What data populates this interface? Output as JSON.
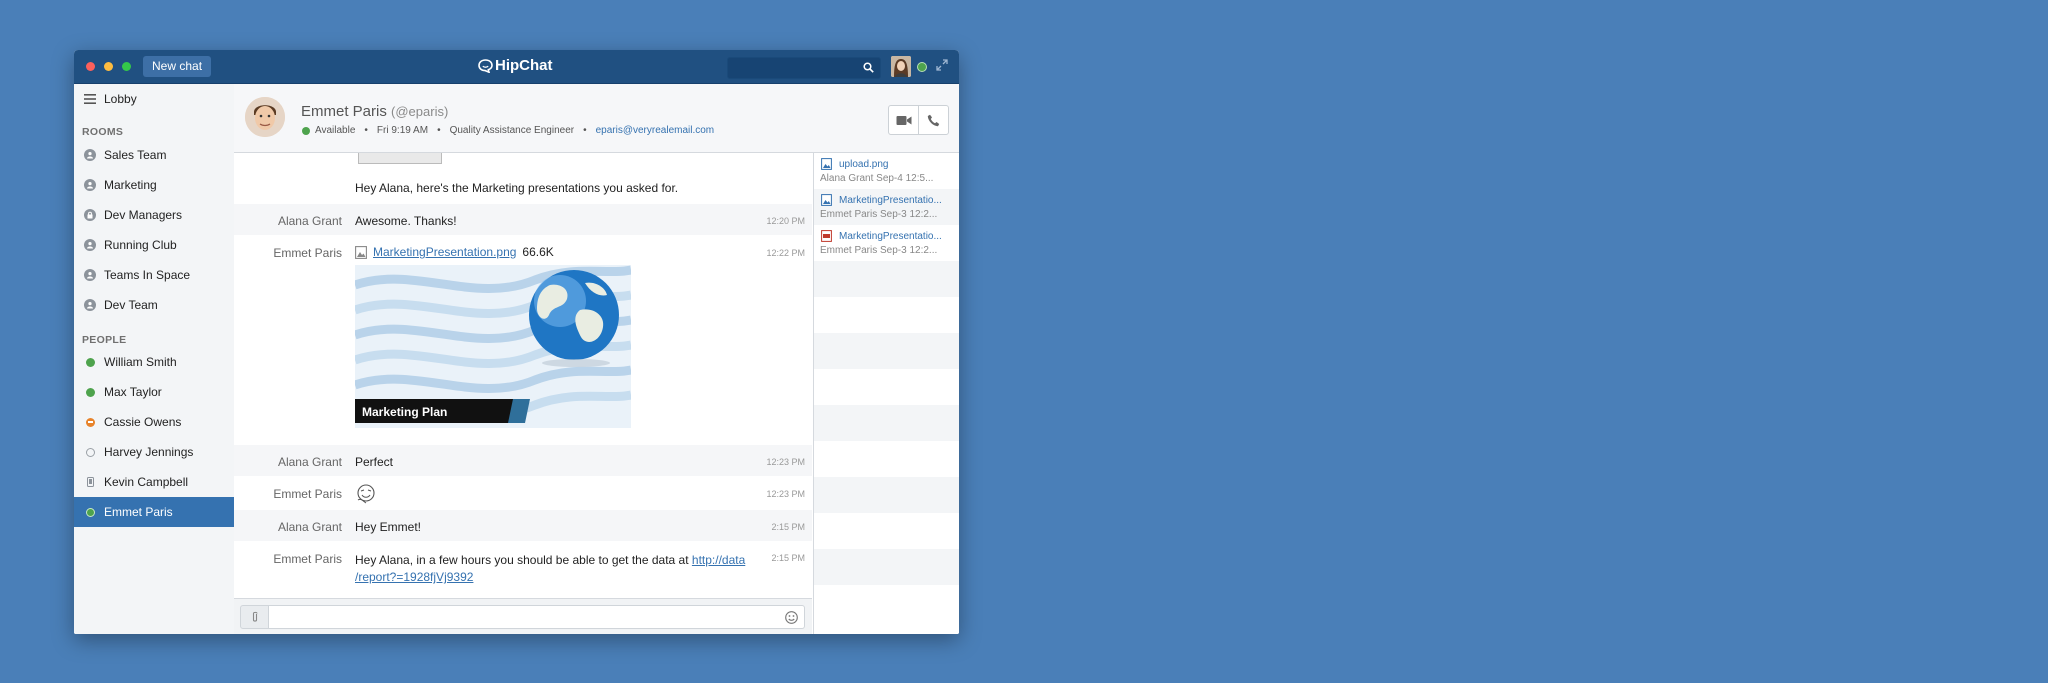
{
  "titlebar": {
    "new_chat_label": "New chat",
    "app_title": "HipChat",
    "search_placeholder": ""
  },
  "sidebar": {
    "lobby_label": "Lobby",
    "rooms_header": "ROOMS",
    "rooms": [
      {
        "label": "Sales Team"
      },
      {
        "label": "Marketing"
      },
      {
        "label": "Dev Managers"
      },
      {
        "label": "Running Club"
      },
      {
        "label": "Teams In Space"
      },
      {
        "label": "Dev Team"
      }
    ],
    "people_header": "PEOPLE",
    "people": [
      {
        "label": "William Smith",
        "status": "available"
      },
      {
        "label": "Max Taylor",
        "status": "available"
      },
      {
        "label": "Cassie Owens",
        "status": "dnd"
      },
      {
        "label": "Harvey Jennings",
        "status": "offline"
      },
      {
        "label": "Kevin Campbell",
        "status": "mobile"
      },
      {
        "label": "Emmet Paris",
        "status": "available",
        "active": true
      }
    ]
  },
  "chat_header": {
    "name": "Emmet Paris",
    "handle": "(@eparis)",
    "status": "Available",
    "local_time": "Fri 9:19 AM",
    "title": "Quality Assistance Engineer",
    "email": "eparis@veryrealemail.com",
    "separator": "•"
  },
  "messages": [
    {
      "sender": "",
      "text": "Hey Alana, here's the Marketing presentations you asked for.",
      "time": ""
    },
    {
      "sender": "Alana Grant",
      "text": "Awesome. Thanks!",
      "time": "12:20 PM"
    },
    {
      "sender": "Emmet Paris",
      "file_name": "MarketingPresentation.png",
      "file_size": "66.6K",
      "preview_caption": "Marketing Plan",
      "time": "12:22 PM"
    },
    {
      "sender": "Alana Grant",
      "text": "Perfect",
      "time": "12:23 PM"
    },
    {
      "sender": "Emmet Paris",
      "text": "",
      "emoticon": "emoticon",
      "time": "12:23 PM"
    },
    {
      "sender": "Alana Grant",
      "text": "Hey Emmet!",
      "time": "2:15 PM"
    },
    {
      "sender": "Emmet Paris",
      "text": "Hey Alana, in a few hours you should be able to get the data at ",
      "link_line1": "http://data",
      "link_line2": "/report?=1928fjVj9392",
      "time": "2:15 PM"
    }
  ],
  "composer": {
    "placeholder": ""
  },
  "files": [
    {
      "name": "upload.png",
      "meta": "Alana Grant   Sep-4 12:5...",
      "icon": "image-file-icon"
    },
    {
      "name": "MarketingPresentatio...",
      "meta": "Emmet Paris  Sep-3 12:2...",
      "icon": "image-file-icon"
    },
    {
      "name": "MarketingPresentatio...",
      "meta": "Emmet Paris  Sep-3 12:2...",
      "icon": "pdf-file-icon"
    }
  ],
  "colors": {
    "background": "#4a7fb8",
    "titlebar": "#205081",
    "active_item": "#3572b0",
    "available": "#4ea34d",
    "dnd": "#e8832a",
    "link": "#3572b0"
  }
}
